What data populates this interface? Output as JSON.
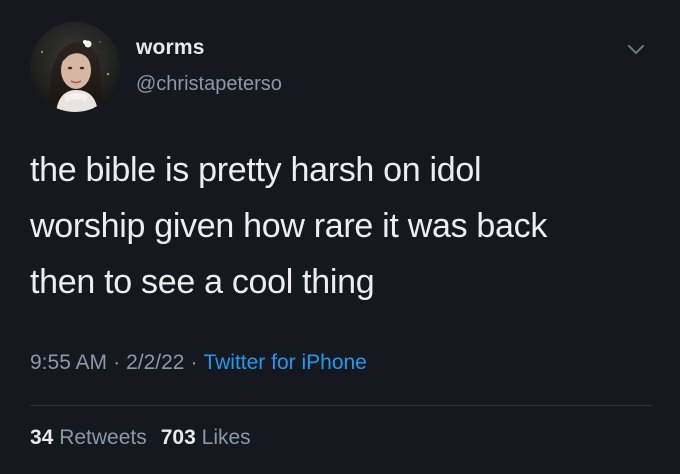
{
  "user": {
    "name": "worms",
    "handle": "@christapeterso"
  },
  "tweet": {
    "text": "the bible is pretty harsh on idol\nworship given how rare it was back\nthen to see a cool thing",
    "time": "9:55 AM",
    "date": "2/2/22",
    "separator": "·",
    "source": "Twitter for iPhone"
  },
  "stats": {
    "retweets_count": "34",
    "retweets_label": "Retweets",
    "likes_count": "703",
    "likes_label": "Likes"
  },
  "icons": {
    "menu": "chevron-down-icon"
  },
  "colors": {
    "background": "#15181f",
    "accent": "#1d9bf0",
    "secondary_text": "#8b98a5"
  }
}
